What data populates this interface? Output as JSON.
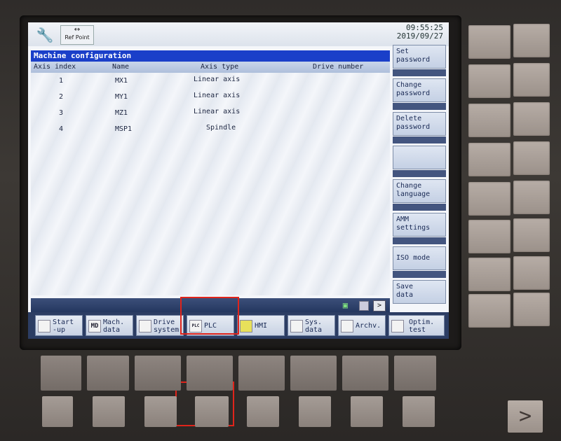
{
  "clock": {
    "time": "09:55:25",
    "date": "2019/09/27"
  },
  "topbar": {
    "ref_point_label": "Ref Point"
  },
  "title": "Machine configuration",
  "table": {
    "headers": [
      "Axis index",
      "Name",
      "Axis type",
      "Drive number"
    ],
    "rows": [
      {
        "index": "1",
        "name": "MX1",
        "type": "Linear axis"
      },
      {
        "index": "2",
        "name": "MY1",
        "type": "Linear axis"
      },
      {
        "index": "3",
        "name": "MZ1",
        "type": "Linear axis"
      },
      {
        "index": "4",
        "name": "MSP1",
        "type": "Spindle"
      }
    ]
  },
  "vertical_softkeys": [
    {
      "line1": "Set",
      "line2": "password"
    },
    {
      "line1": "Change",
      "line2": "password"
    },
    {
      "line1": "Delete",
      "line2": "password"
    },
    {
      "line1": "",
      "line2": ""
    },
    {
      "line1": "Change",
      "line2": "language"
    },
    {
      "line1": "AMM",
      "line2": "settings"
    },
    {
      "line1": "ISO mode",
      "line2": ""
    },
    {
      "line1": "Save",
      "line2": "data"
    }
  ],
  "horizontal_softkeys": [
    {
      "icon": "",
      "line1": "Start",
      "line2": "-up"
    },
    {
      "icon": "MD",
      "line1": "Mach.",
      "line2": "data"
    },
    {
      "icon": "",
      "line1": "Drive",
      "line2": "system"
    },
    {
      "icon": "PLC",
      "line1": "PLC",
      "line2": ""
    },
    {
      "icon": "",
      "line1": "HMI",
      "line2": ""
    },
    {
      "icon": "",
      "line1": "Sys.",
      "line2": "data"
    },
    {
      "icon": "",
      "line1": "Archv.",
      "line2": ""
    },
    {
      "icon": "",
      "line1": "Optim.",
      "line2": "test"
    }
  ],
  "status": {
    "next_label": ">"
  },
  "panel": {
    "arrow_key": ">"
  },
  "colors": {
    "title_bar": "#1a3fc9",
    "highlight": "#e0241b"
  }
}
